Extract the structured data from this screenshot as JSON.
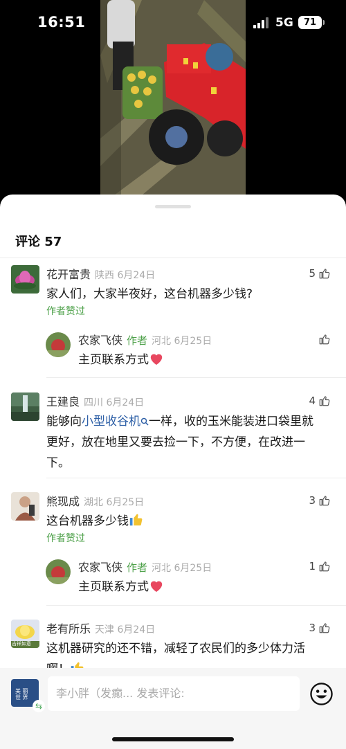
{
  "status_bar": {
    "time": "16:51",
    "network": "5G",
    "battery": "71"
  },
  "comments_header": {
    "title": "评论 57"
  },
  "comments": [
    {
      "user": "花开富贵",
      "location": "陕西",
      "date": "6月24日",
      "text": "家人们，大家半夜好，这台机器多少钱?",
      "likes": "5",
      "liked_by_author": "作者赞过",
      "replies": [
        {
          "user": "农家飞侠",
          "author_tag": "作者",
          "location": "河北",
          "date": "6月25日",
          "text": "主页联系方式",
          "likes": ""
        }
      ]
    },
    {
      "user": "王建良",
      "location": "四川",
      "date": "6月24日",
      "text_before": "能够向",
      "text_link": "小型收谷机",
      "text_after": "一样，收的玉米能装进口袋里就更好，放在地里又要去捡一下，不方便，在改进一下。",
      "likes": "4"
    },
    {
      "user": "熊现成",
      "location": "湖北",
      "date": "6月25日",
      "text": "这台机器多少钱",
      "likes": "3",
      "liked_by_author": "作者赞过",
      "replies": [
        {
          "user": "农家飞侠",
          "author_tag": "作者",
          "location": "河北",
          "date": "6月25日",
          "text": "主页联系方式",
          "likes": "1"
        }
      ]
    },
    {
      "user": "老有所乐",
      "location": "天津",
      "date": "6月24日",
      "text": "这机器研究的还不错，减轻了农民们的多少体力活啊！",
      "likes": "3",
      "avatar_text": "吉祥如意"
    }
  ],
  "input_bar": {
    "placeholder": "李小胖（发癫... 发表评论:",
    "my_avatar_text": "美 丽\n世 界"
  },
  "colors": {
    "accent_green": "#4ea14a",
    "link_blue": "#2d5fa6",
    "heart_red": "#e8475f",
    "thumb_yellow": "#f2c230"
  },
  "icons": [
    "signal-icon",
    "battery-icon",
    "thumb-up-icon",
    "search-icon",
    "heart-icon",
    "emoji-icon",
    "switch-icon"
  ]
}
